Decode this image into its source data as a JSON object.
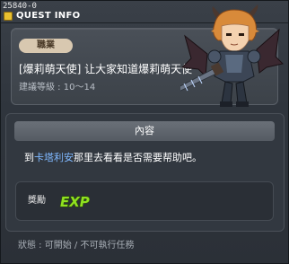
{
  "window": {
    "id_label": "25840-0",
    "title": "QUEST INFO"
  },
  "quest": {
    "job_badge": "職業",
    "title": "[爆莉萌天使] 让大家知道爆莉萌天使",
    "level_label": "建議等級 : 10～14"
  },
  "content": {
    "header": "內容",
    "text_before": "到",
    "npc_name": "卡塔利安",
    "text_after": "那里去看看是否需要帮助吧。"
  },
  "reward": {
    "label": "獎勵",
    "icon": "exp-icon",
    "icon_text": "EXP"
  },
  "status": {
    "text": "狀態 : 可開始 / 不可執行任務"
  },
  "colors": {
    "npc_highlight": "#7fb8ff",
    "exp_green": "#8fe020",
    "badge_bg": "#d8c8b0"
  }
}
